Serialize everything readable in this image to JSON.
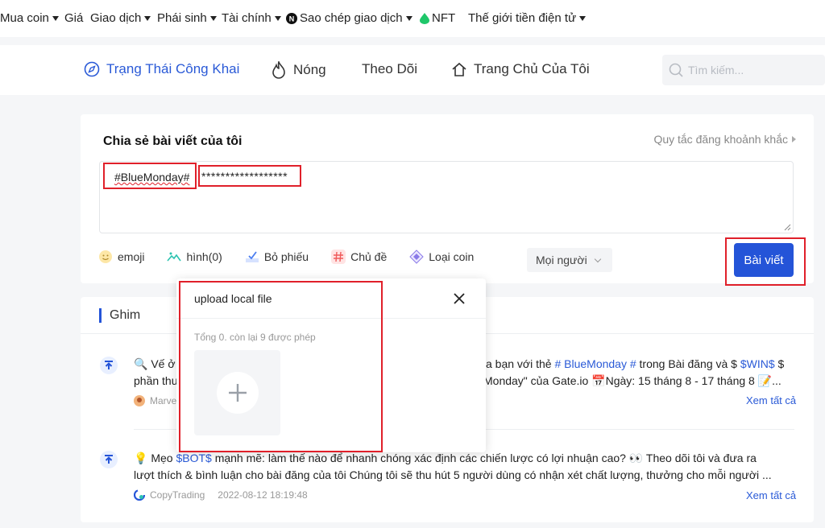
{
  "topnav": {
    "items": [
      {
        "label": "Mua coin",
        "has_caret": true
      },
      {
        "label": "Giá",
        "has_caret": false
      },
      {
        "label": "Giao dịch",
        "has_caret": true
      },
      {
        "label": "Phái sinh",
        "has_caret": true
      },
      {
        "label": "Tài chính",
        "has_caret": true
      },
      {
        "label": "Sao chép giao dịch",
        "has_caret": true
      },
      {
        "label": "NFT",
        "has_caret": false
      },
      {
        "label": "Thế giới tiền điện tử",
        "has_caret": true
      }
    ]
  },
  "subnav": {
    "tabs": [
      {
        "label": "Trạng Thái Công Khai",
        "icon": "compass-icon",
        "active": true
      },
      {
        "label": "Nóng",
        "icon": "flame-icon",
        "active": false
      },
      {
        "label": "Theo Dõi",
        "icon": "",
        "active": false
      },
      {
        "label": "Trang Chủ Của Tôi",
        "icon": "home-icon",
        "active": false
      }
    ],
    "search_placeholder": "Tìm kiếm..."
  },
  "composer": {
    "title": "Chia sẻ bài viết của tôi",
    "rules_link": "Quy tắc đăng khoảnh khắc",
    "hashtag": "#BlueMonday#",
    "masked_text": "******************",
    "tools": [
      "emoji",
      "hình(0)",
      "Bỏ phiếu",
      "Chủ đề",
      "Loại coin"
    ],
    "audience": "Mọi người",
    "post_button": "Bài viết"
  },
  "pinned": {
    "header": "Ghim",
    "posts": [
      {
        "line1_a": "🔍 Vế ở",
        "line1_b": "a bạn với thẻ ",
        "line1_tag": "# BlueMonday #",
        "line1_c": " trong Bài đăng và $ ",
        "line1_tag2": "$WIN$",
        "line1_d": " $",
        "line2_a": "phần thư",
        "line2_b": "Monday\" của Gate.io 📅Ngày: 15 tháng 8 - 17 tháng 8 📝...",
        "author": "Marve",
        "see_all": "Xem tất cả"
      },
      {
        "line1_a": "💡 Mẹo ",
        "line1_tag": "$BOT$",
        "line1_b": " mạnh mẽ: làm thế nào để nhanh chóng xác định các chiến lược có lợi nhuận cao? 👀 Theo dõi tôi và đưa ra",
        "line2": "lượt thích & bình luận cho bài đăng của tôi Chúng tôi sẽ thu hút 5 người dùng có nhận xét chất lượng, thưởng cho mỗi người ...",
        "author": "CopyTrading",
        "timestamp": "2022-08-12 18:19:48",
        "see_all": "Xem tất cả"
      }
    ]
  },
  "upload_modal": {
    "title": "upload local file",
    "count_text": "Tổng 0. còn lại 9 được phép"
  },
  "colors": {
    "accent": "#2454d8",
    "highlight": "#e0202a",
    "link": "#2a5ad7"
  }
}
